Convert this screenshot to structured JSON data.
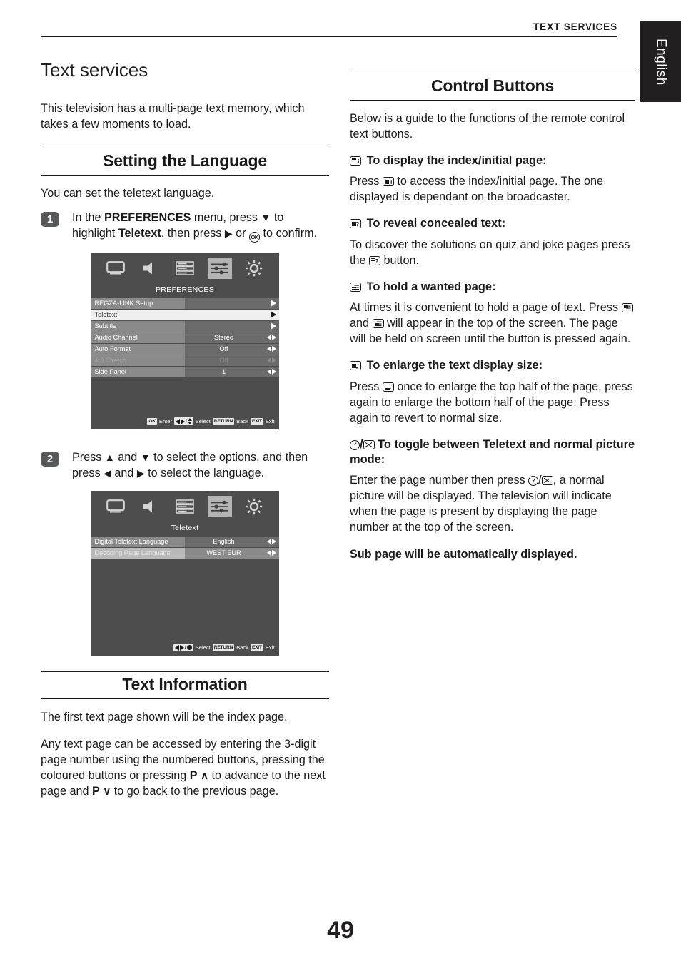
{
  "running_head": "TEXT SERVICES",
  "language_tab": "English",
  "page_number": "49",
  "left": {
    "title": "Text services",
    "intro": "This television has a multi-page text memory, which takes a few moments to load.",
    "section_language": "Setting the Language",
    "language_intro": "You can set the teletext language.",
    "step1": {
      "num": "1",
      "t1": "In the ",
      "b1": "PREFERENCES",
      "t2": " menu, press ",
      "arrow_down": "▼",
      "t3": " to highlight ",
      "b2": "Teletext",
      "t4": ", then press ",
      "arrow_right": "▶",
      "t5": " or ",
      "ok": "OK",
      "t6": " to confirm."
    },
    "step2": {
      "num": "2",
      "t1": "Press ",
      "arrow_up": "▲",
      "t2": " and ",
      "arrow_down": "▼",
      "t3": " to select the options, and then press ",
      "arrow_left": "◀",
      "t4": " and ",
      "arrow_right": "▶",
      "t5": " to select the language."
    },
    "section_textinfo": "Text Information",
    "textinfo_p1": "The first text page shown will be the index page.",
    "textinfo_p2": {
      "t1": "Any text page can be accessed by entering the 3-digit page number using the numbered buttons, pressing the coloured buttons or pressing ",
      "b1": "P",
      "chev_up": "∧",
      "t2": " to advance to the next page and ",
      "b2": "P",
      "chev_down": "∨",
      "t3": " to go back to the previous page."
    }
  },
  "right": {
    "section_control": "Control Buttons",
    "intro": "Below is a guide to the functions of the remote control text buttons.",
    "blocks": [
      {
        "icon": "teletext-index-icon",
        "heading": "To display the index/initial page:",
        "body_before": "Press ",
        "body_after": " to access the index/initial page. The one displayed is dependant on the broadcaster."
      },
      {
        "icon": "teletext-reveal-icon",
        "heading": "To reveal concealed text:",
        "body_before": "To discover the solutions on quiz and joke pages press the ",
        "body_after": " button."
      },
      {
        "icon": "teletext-hold-icon",
        "heading": "To hold a wanted page:",
        "body_before": "At times it is convenient to hold a page of text. Press ",
        "body_mid": " and ",
        "body_after": " will appear in the top of the screen. The page will be held on screen until the button is pressed again."
      },
      {
        "icon": "teletext-enlarge-icon",
        "heading": "To enlarge the text display size:",
        "body_before": "Press ",
        "body_after": " once to enlarge the top half of the page, press again to enlarge the bottom half of the page. Press again to revert to normal size."
      },
      {
        "icon": "teletext-toggle-icon",
        "heading": "To toggle between Teletext and normal picture mode:",
        "body_before": "Enter the page number then press ",
        "body_after": ", a normal picture will be displayed. The television will indicate when the page is present by displaying the page number at the top of the screen."
      }
    ],
    "closing_bold": "Sub page will be automatically displayed."
  },
  "osd1": {
    "title": "PREFERENCES",
    "icons": [
      "screen-icon",
      "speaker-icon",
      "list-icon",
      "sliders-icon",
      "brightness-icon"
    ],
    "selected_icon_index": 3,
    "rows": [
      {
        "label": "REGZA-LINK Setup",
        "value": "",
        "control": "arrow-right",
        "state": "normal"
      },
      {
        "label": "Teletext",
        "value": "",
        "control": "arrow-right",
        "state": "highlight"
      },
      {
        "label": "Subtitle",
        "value": "",
        "control": "arrow-right",
        "state": "normal"
      },
      {
        "label": "Audio Channel",
        "value": "Stereo",
        "control": "left-right",
        "state": "normal"
      },
      {
        "label": "Auto Format",
        "value": "Off",
        "control": "left-right",
        "state": "normal"
      },
      {
        "label": "4:3 Stretch",
        "value": "Off",
        "control": "left-right",
        "state": "dim"
      },
      {
        "label": "Side Panel",
        "value": "1",
        "control": "left-right",
        "state": "normal"
      }
    ],
    "footer": {
      "k1": "OK",
      "l1": "Enter",
      "l2": "Select",
      "k3": "RETURN",
      "l3": "Back",
      "k4": "EXIT",
      "l4": "Exit"
    }
  },
  "osd2": {
    "title": "Teletext",
    "icons": [
      "screen-icon",
      "speaker-icon",
      "list-icon",
      "sliders-icon",
      "brightness-icon"
    ],
    "selected_icon_index": 3,
    "rows": [
      {
        "label": "Digital Teletext Language",
        "value": "English",
        "control": "left-right",
        "state": "normal"
      },
      {
        "label": "Decoding Page Language",
        "value": "WEST EUR",
        "control": "left-right",
        "state": "selected2"
      }
    ],
    "footer": {
      "l2": "Select",
      "k3": "RETURN",
      "l3": "Back",
      "k4": "EXIT",
      "l4": "Exit"
    }
  }
}
